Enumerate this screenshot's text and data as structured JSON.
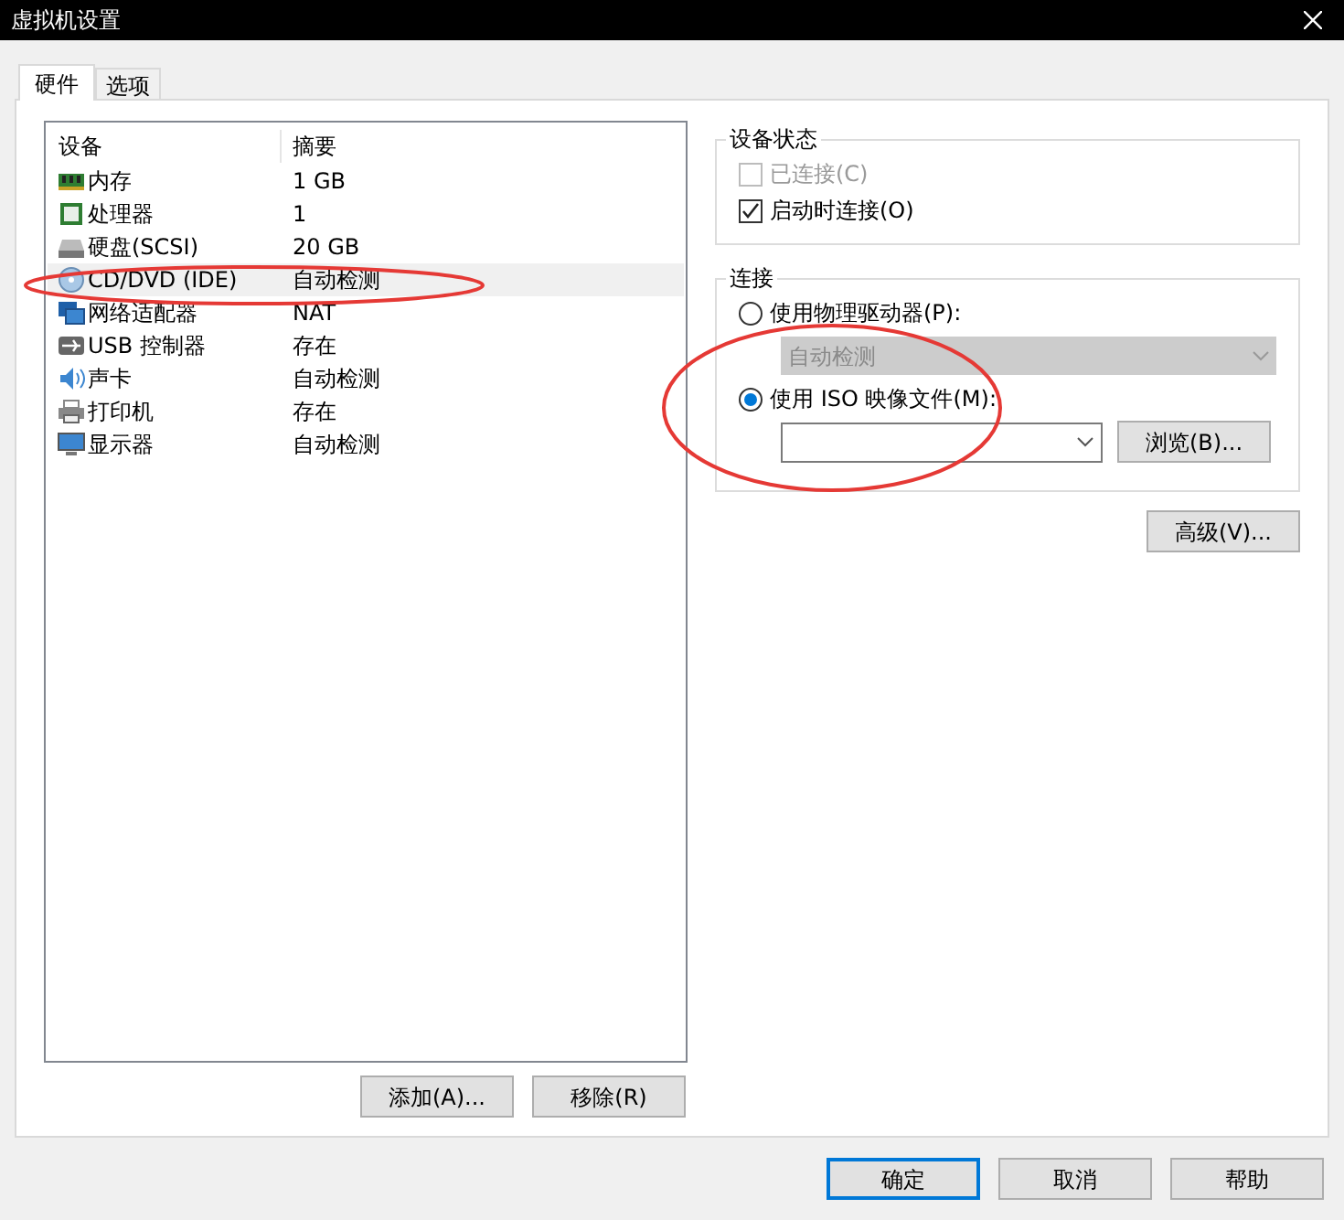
{
  "window": {
    "title": "虚拟机设置"
  },
  "tabs": [
    {
      "label": "硬件",
      "selected": true
    },
    {
      "label": "选项",
      "selected": false
    }
  ],
  "devices": {
    "columns": [
      "设备",
      "摘要"
    ],
    "rows": [
      {
        "kind": "memory",
        "name": "内存",
        "summary": "1 GB",
        "selected": false
      },
      {
        "kind": "cpu",
        "name": "处理器",
        "summary": "1",
        "selected": false
      },
      {
        "kind": "disk",
        "name": "硬盘(SCSI)",
        "summary": "20 GB",
        "selected": false
      },
      {
        "kind": "cd",
        "name": "CD/DVD (IDE)",
        "summary": "自动检测",
        "selected": true
      },
      {
        "kind": "network",
        "name": "网络适配器",
        "summary": "NAT",
        "selected": false
      },
      {
        "kind": "usb",
        "name": "USB 控制器",
        "summary": "存在",
        "selected": false
      },
      {
        "kind": "sound",
        "name": "声卡",
        "summary": "自动检测",
        "selected": false
      },
      {
        "kind": "printer",
        "name": "打印机",
        "summary": "存在",
        "selected": false
      },
      {
        "kind": "display",
        "name": "显示器",
        "summary": "自动检测",
        "selected": false
      }
    ],
    "buttons": [
      "添加(A)...",
      "移除(R)"
    ]
  },
  "device_status": {
    "title": "设备状态",
    "checkboxes": [
      {
        "label": "已连接(C)",
        "checked": false,
        "disabled": true
      },
      {
        "label": "启动时连接(O)",
        "checked": true,
        "disabled": false
      }
    ]
  },
  "connection": {
    "title": "连接",
    "physical": {
      "label": "使用物理驱动器(P):",
      "selected": false,
      "value": "自动检测",
      "disabled": true
    },
    "iso": {
      "label": "使用 ISO 映像文件(M):",
      "selected": true,
      "browse": "浏览(B)..."
    }
  },
  "advanced_button": "高级(V)...",
  "footer_buttons": [
    {
      "label": "确定",
      "default": true
    },
    {
      "label": "取消",
      "default": false
    },
    {
      "label": "帮助",
      "default": false
    }
  ]
}
